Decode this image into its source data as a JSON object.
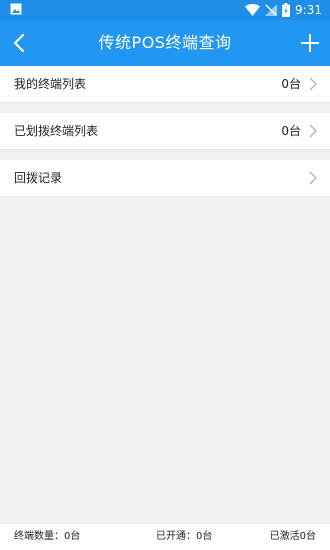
{
  "status_bar": {
    "time": "9:31",
    "icons": [
      "image-icon",
      "wifi-icon",
      "no-sim-icon",
      "battery-icon"
    ]
  },
  "header": {
    "title": "传统POS终端查询",
    "back_icon": "back-arrow-icon",
    "add_icon": "plus-icon"
  },
  "menu": [
    {
      "label": "我的终端列表",
      "count": "0台"
    },
    {
      "label": "已划拨终端列表",
      "count": "0台"
    },
    {
      "label": "回拨记录",
      "count": ""
    }
  ],
  "footer": {
    "terminal_count": "终端数量：0台",
    "opened": "已开通：0台",
    "activated": "已激活0台"
  },
  "colors": {
    "status_bar": "#1e8ee6",
    "header": "#2196f3",
    "background": "#f1f1f1"
  }
}
